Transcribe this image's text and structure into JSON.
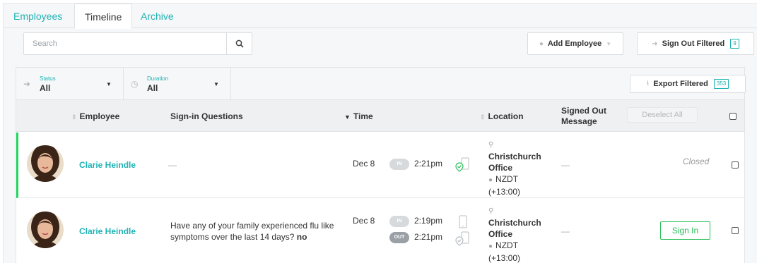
{
  "tabs": [
    {
      "label": "Employees"
    },
    {
      "label": "Timeline"
    },
    {
      "label": "Archive"
    }
  ],
  "search": {
    "placeholder": "Search",
    "value": ""
  },
  "toolbar": {
    "add_employee_label": "Add Employee",
    "sign_out_filtered_label": "Sign Out Filtered",
    "sign_out_filtered_count": "9"
  },
  "filters": {
    "status": {
      "label": "Status",
      "value": "All"
    },
    "duration": {
      "label": "Duration",
      "value": "All"
    },
    "export_label": "Export Filtered",
    "export_count": "353"
  },
  "table": {
    "headers": {
      "employee": "Employee",
      "questions": "Sign-in Questions",
      "time": "Time",
      "location": "Location",
      "signed_out_message": "Signed Out Message",
      "deselect_all": "Deselect All"
    },
    "rows": [
      {
        "name": "Clarie Heindle",
        "question": "—",
        "date": "Dec 8",
        "in_label": "IN",
        "in_time": "2:21pm",
        "location": "Christchurch Office",
        "timezone": "NZDT (+13:00)",
        "message": "—",
        "status": "Closed"
      },
      {
        "name": "Clarie Heindle",
        "question": "Have any of your family experienced flu like symptoms over the last 14 days?",
        "answer": "no",
        "date": "Dec 8",
        "in_label": "IN",
        "in_time": "2:19pm",
        "out_label": "OUT",
        "out_time": "2:21pm",
        "location": "Christchurch Office",
        "timezone": "NZDT (+13:00)",
        "message": "—",
        "action_label": "Sign In"
      }
    ]
  },
  "colors": {
    "accent": "#1fb3b5",
    "active_row_bar": "#1ed760",
    "sign_in_green": "#2bbf5a"
  }
}
